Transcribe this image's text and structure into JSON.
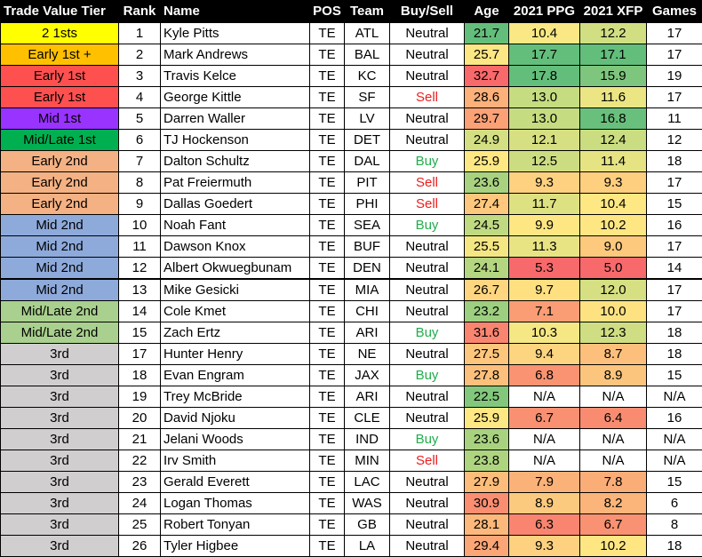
{
  "headers": {
    "tier": "Trade Value Tier",
    "rank": "Rank",
    "name": "Name",
    "pos": "POS",
    "team": "Team",
    "buysell": "Buy/Sell",
    "age": "Age",
    "ppg": "2021 PPG",
    "xfp": "2021 XFP",
    "games": "Games"
  },
  "tier_colors": {
    "2 1sts": "#ffff00",
    "Early 1st +": "#ffc000",
    "Early 1st": "#ff5050",
    "Mid 1st": "#9933ff",
    "Mid/Late 1st": "#00b050",
    "Early 2nd": "#f4b183",
    "Mid 2nd": "#8eaadb",
    "Mid/Late 2nd": "#a9d08e",
    "3rd": "#d0cece"
  },
  "rows": [
    {
      "tier": "2 1sts",
      "rank": "1",
      "name": "Kyle Pitts",
      "pos": "TE",
      "team": "ATL",
      "buysell": "Neutral",
      "age": "21.7",
      "ppg": "10.4",
      "xfp": "12.2",
      "games": "17",
      "age_bg": "#63be7b",
      "ppg_bg": "#f9e883",
      "xfp_bg": "#d1df82"
    },
    {
      "tier": "Early 1st +",
      "rank": "2",
      "name": "Mark Andrews",
      "pos": "TE",
      "team": "BAL",
      "buysell": "Neutral",
      "age": "25.7",
      "ppg": "17.7",
      "xfp": "17.1",
      "games": "17",
      "age_bg": "#fbe783",
      "ppg_bg": "#63be7b",
      "xfp_bg": "#63be7b"
    },
    {
      "tier": "Early 1st",
      "rank": "3",
      "name": "Travis Kelce",
      "pos": "TE",
      "team": "KC",
      "buysell": "Neutral",
      "age": "32.7",
      "ppg": "17.8",
      "xfp": "15.9",
      "games": "19",
      "age_bg": "#f8696b",
      "ppg_bg": "#63be7b",
      "xfp_bg": "#7ec67d"
    },
    {
      "tier": "Early 1st",
      "rank": "4",
      "name": "George Kittle",
      "pos": "TE",
      "team": "SF",
      "buysell": "Sell",
      "age": "28.6",
      "ppg": "13.0",
      "xfp": "11.6",
      "games": "17",
      "age_bg": "#fcb07a",
      "ppg_bg": "#c5dc81",
      "xfp_bg": "#ebe583"
    },
    {
      "tier": "Mid 1st",
      "rank": "5",
      "name": "Darren Waller",
      "pos": "TE",
      "team": "LV",
      "buysell": "Neutral",
      "age": "29.7",
      "ppg": "13.0",
      "xfp": "16.8",
      "games": "11",
      "age_bg": "#fba176",
      "ppg_bg": "#c5dc81",
      "xfp_bg": "#69c07c"
    },
    {
      "tier": "Mid/Late 1st",
      "rank": "6",
      "name": "TJ Hockenson",
      "pos": "TE",
      "team": "DET",
      "buysell": "Neutral",
      "age": "24.9",
      "ppg": "12.1",
      "xfp": "12.4",
      "games": "12",
      "age_bg": "#d3df82",
      "ppg_bg": "#d6e082",
      "xfp_bg": "#cbdd81"
    },
    {
      "tier": "Early 2nd",
      "rank": "7",
      "name": "Dalton Schultz",
      "pos": "TE",
      "team": "DAL",
      "buysell": "Buy",
      "age": "25.9",
      "ppg": "12.5",
      "xfp": "11.4",
      "games": "18",
      "age_bg": "#fee883",
      "ppg_bg": "#ccdd81",
      "xfp_bg": "#e6e383"
    },
    {
      "tier": "Early 2nd",
      "rank": "8",
      "name": "Pat Freiermuth",
      "pos": "TE",
      "team": "PIT",
      "buysell": "Sell",
      "age": "23.6",
      "ppg": "9.3",
      "xfp": "9.3",
      "games": "17",
      "age_bg": "#a8d27f",
      "ppg_bg": "#fdd17f",
      "xfp_bg": "#fdcf7e"
    },
    {
      "tier": "Early 2nd",
      "rank": "9",
      "name": "Dallas Goedert",
      "pos": "TE",
      "team": "PHI",
      "buysell": "Sell",
      "age": "27.4",
      "ppg": "11.7",
      "xfp": "10.4",
      "games": "15",
      "age_bg": "#fdc87d",
      "ppg_bg": "#dde182",
      "xfp_bg": "#fee883"
    },
    {
      "tier": "Mid 2nd",
      "rank": "10",
      "name": "Noah Fant",
      "pos": "TE",
      "team": "SEA",
      "buysell": "Buy",
      "age": "24.5",
      "ppg": "9.9",
      "xfp": "10.2",
      "games": "16",
      "age_bg": "#c0da81",
      "ppg_bg": "#fee783",
      "xfp_bg": "#fee683"
    },
    {
      "tier": "Mid 2nd",
      "rank": "11",
      "name": "Dawson Knox",
      "pos": "TE",
      "team": "BUF",
      "buysell": "Neutral",
      "age": "25.5",
      "ppg": "11.3",
      "xfp": "9.0",
      "games": "17",
      "age_bg": "#f4e683",
      "ppg_bg": "#e9e483",
      "xfp_bg": "#fdc97d"
    },
    {
      "tier": "Mid 2nd",
      "rank": "12",
      "name": "Albert Okwuegbunam",
      "pos": "TE",
      "team": "DEN",
      "buysell": "Neutral",
      "age": "24.1",
      "ppg": "5.3",
      "xfp": "5.0",
      "games": "14",
      "age_bg": "#b5d680",
      "ppg_bg": "#f8696b",
      "xfp_bg": "#f8696b"
    },
    {
      "tier": "Mid 2nd",
      "rank": "13",
      "name": "Mike Gesicki",
      "pos": "TE",
      "team": "MIA",
      "buysell": "Neutral",
      "age": "26.7",
      "ppg": "9.7",
      "xfp": "12.0",
      "games": "17",
      "age_bg": "#fed680",
      "ppg_bg": "#fee080",
      "xfp_bg": "#d6e082",
      "thick": true
    },
    {
      "tier": "Mid/Late 2nd",
      "rank": "14",
      "name": "Cole Kmet",
      "pos": "TE",
      "team": "CHI",
      "buysell": "Neutral",
      "age": "23.2",
      "ppg": "7.1",
      "xfp": "10.0",
      "games": "17",
      "age_bg": "#9ccf7f",
      "ppg_bg": "#fa9d75",
      "xfp_bg": "#fee282"
    },
    {
      "tier": "Mid/Late 2nd",
      "rank": "15",
      "name": "Zach Ertz",
      "pos": "TE",
      "team": "ARI",
      "buysell": "Buy",
      "age": "31.6",
      "ppg": "10.3",
      "xfp": "12.3",
      "games": "18",
      "age_bg": "#f98570",
      "ppg_bg": "#f5e783",
      "xfp_bg": "#cfde82"
    },
    {
      "tier": "3rd",
      "rank": "17",
      "name": "Hunter Henry",
      "pos": "TE",
      "team": "NE",
      "buysell": "Neutral",
      "age": "27.5",
      "ppg": "9.4",
      "xfp": "8.7",
      "games": "18",
      "age_bg": "#fdc67d",
      "ppg_bg": "#fdd47f",
      "xfp_bg": "#fcc07c"
    },
    {
      "tier": "3rd",
      "rank": "18",
      "name": "Evan Engram",
      "pos": "TE",
      "team": "JAX",
      "buysell": "Buy",
      "age": "27.8",
      "ppg": "6.8",
      "xfp": "8.9",
      "games": "15",
      "age_bg": "#fcc07c",
      "ppg_bg": "#f99372",
      "xfp_bg": "#fcc57d"
    },
    {
      "tier": "3rd",
      "rank": "19",
      "name": "Trey McBride",
      "pos": "TE",
      "team": "ARI",
      "buysell": "Neutral",
      "age": "22.5",
      "ppg": "N/A",
      "xfp": "N/A",
      "games": "N/A",
      "age_bg": "#83c77d",
      "ppg_bg": "#ffffff",
      "xfp_bg": "#ffffff"
    },
    {
      "tier": "3rd",
      "rank": "20",
      "name": "David Njoku",
      "pos": "TE",
      "team": "CLE",
      "buysell": "Neutral",
      "age": "25.9",
      "ppg": "6.7",
      "xfp": "6.4",
      "games": "16",
      "age_bg": "#fee883",
      "ppg_bg": "#f99071",
      "xfp_bg": "#f98c70"
    },
    {
      "tier": "3rd",
      "rank": "21",
      "name": "Jelani Woods",
      "pos": "TE",
      "team": "IND",
      "buysell": "Buy",
      "age": "23.6",
      "ppg": "N/A",
      "xfp": "N/A",
      "games": "N/A",
      "age_bg": "#a8d27f",
      "ppg_bg": "#ffffff",
      "xfp_bg": "#ffffff"
    },
    {
      "tier": "3rd",
      "rank": "22",
      "name": "Irv Smith",
      "pos": "TE",
      "team": "MIN",
      "buysell": "Sell",
      "age": "23.8",
      "ppg": "N/A",
      "xfp": "N/A",
      "games": "N/A",
      "age_bg": "#aed480",
      "ppg_bg": "#ffffff",
      "xfp_bg": "#ffffff"
    },
    {
      "tier": "3rd",
      "rank": "23",
      "name": "Gerald Everett",
      "pos": "TE",
      "team": "LAC",
      "buysell": "Neutral",
      "age": "27.9",
      "ppg": "7.9",
      "xfp": "7.8",
      "games": "15",
      "age_bg": "#fcbd7b",
      "ppg_bg": "#fbb279",
      "xfp_bg": "#fbad78"
    },
    {
      "tier": "3rd",
      "rank": "24",
      "name": "Logan Thomas",
      "pos": "TE",
      "team": "WAS",
      "buysell": "Neutral",
      "age": "30.9",
      "ppg": "8.9",
      "xfp": "8.2",
      "games": "6",
      "age_bg": "#f98e71",
      "ppg_bg": "#fcca7e",
      "xfp_bg": "#fbb57a"
    },
    {
      "tier": "3rd",
      "rank": "25",
      "name": "Robert Tonyan",
      "pos": "TE",
      "team": "GB",
      "buysell": "Neutral",
      "age": "28.1",
      "ppg": "6.3",
      "xfp": "6.7",
      "games": "8",
      "age_bg": "#fcb97b",
      "ppg_bg": "#f98570",
      "xfp_bg": "#f99272"
    },
    {
      "tier": "3rd",
      "rank": "26",
      "name": "Tyler Higbee",
      "pos": "TE",
      "team": "LA",
      "buysell": "Neutral",
      "age": "29.4",
      "ppg": "9.3",
      "xfp": "10.2",
      "games": "18",
      "age_bg": "#fba677",
      "ppg_bg": "#fdd17f",
      "xfp_bg": "#fee683"
    }
  ]
}
